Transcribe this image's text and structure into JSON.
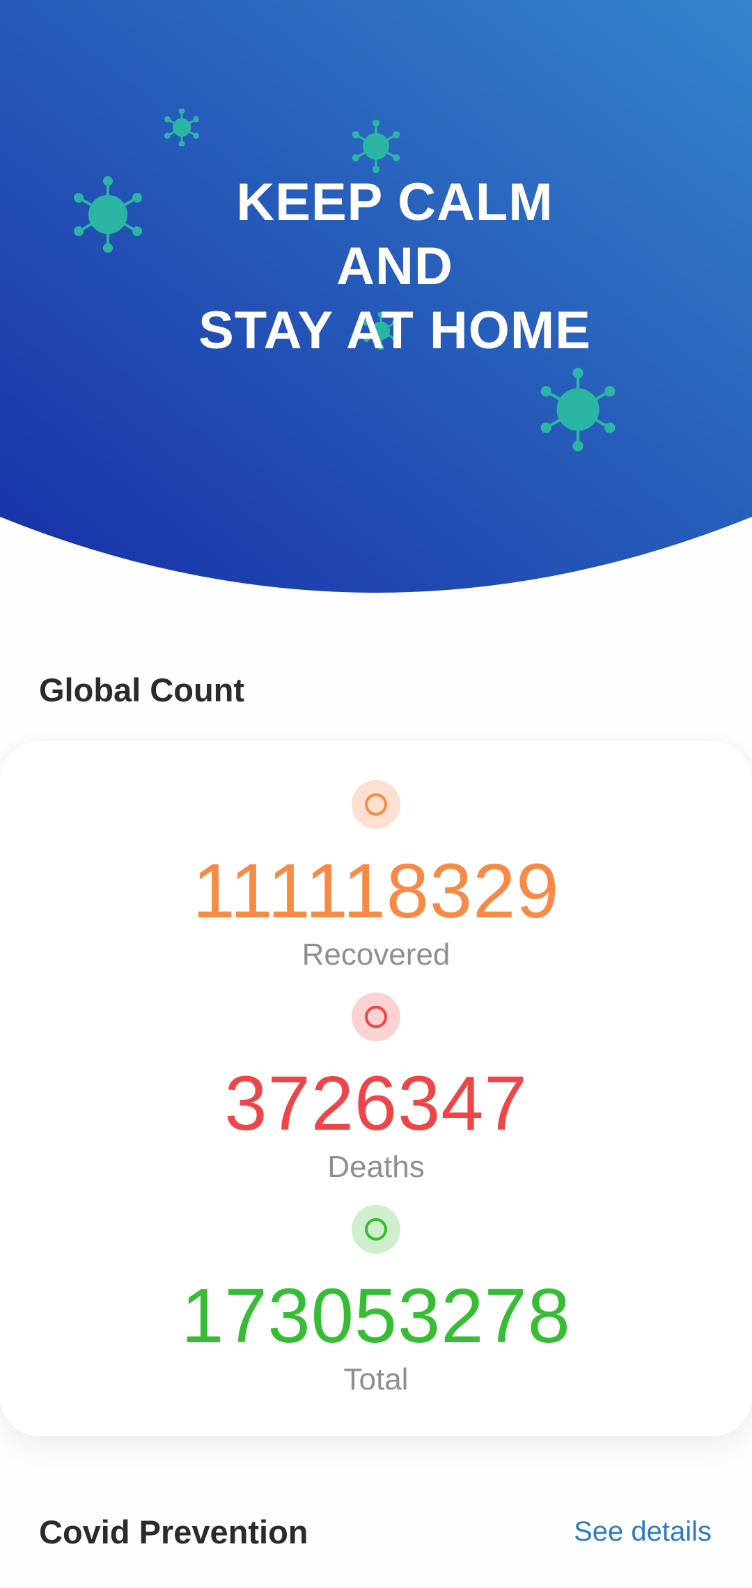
{
  "hero": {
    "line1": "KEEP CALM",
    "line2": "AND",
    "line3": "STAY AT HOME",
    "gradient_start": "#1730a6",
    "gradient_end": "#3584cc",
    "virus_color": "#2bb5a3"
  },
  "global_count": {
    "title": "Global Count",
    "stats": [
      {
        "label": "Recovered",
        "value": "111118329",
        "color": "#f98a46",
        "dot_bg": "#fde0d0",
        "icon": "circle-ring-icon"
      },
      {
        "label": "Deaths",
        "value": "3726347",
        "color": "#ee4648",
        "dot_bg": "#fbd3d3",
        "icon": "circle-ring-icon"
      },
      {
        "label": "Total",
        "value": "173053278",
        "color": "#36bd34",
        "dot_bg": "#cfeecb",
        "icon": "circle-ring-icon"
      }
    ]
  },
  "prevention": {
    "title": "Covid Prevention",
    "see_details": "See details",
    "link_color": "#2d7ac5"
  }
}
